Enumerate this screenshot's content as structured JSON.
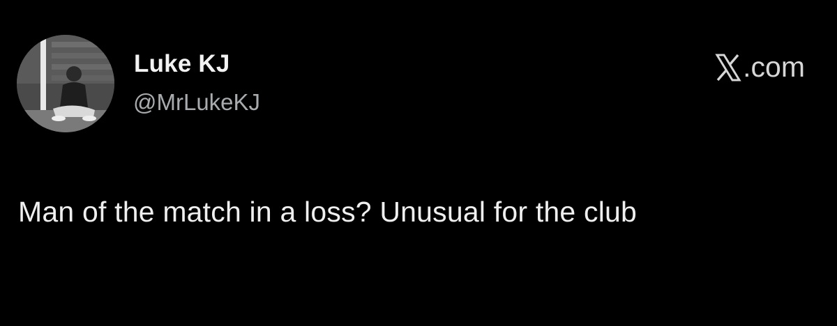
{
  "tweet": {
    "author_name": "Luke KJ",
    "author_handle": "@MrLukeKJ",
    "text": "Man of the match in a loss? Unusual for the club"
  },
  "brand": {
    "icon": "x-logo-icon",
    "label": ".com"
  },
  "colors": {
    "background": "#000000",
    "name": "#f2f2f2",
    "handle": "#a9acaf",
    "text": "#efefef"
  }
}
